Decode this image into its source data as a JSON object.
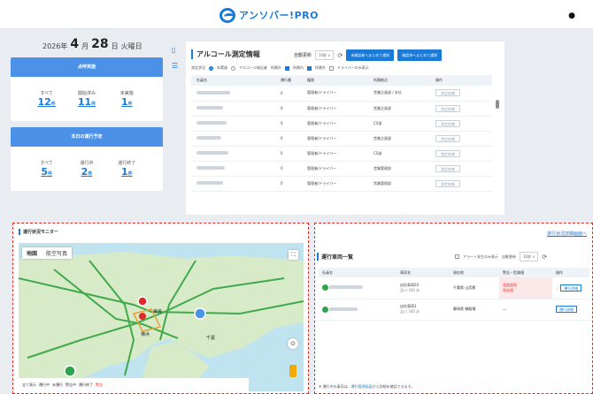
{
  "app": {
    "brand": "アンソバー!PRO",
    "bell": "●"
  },
  "date": {
    "year": "2026年",
    "month": "4",
    "month_suffix": "月",
    "day": "28",
    "day_suffix": "日",
    "weekday": "火曜日"
  },
  "cards": [
    {
      "title": "点呼実施",
      "items": [
        {
          "label": "すべて",
          "value": "12",
          "unit": "件"
        },
        {
          "label": "開始済み",
          "value": "11",
          "unit": "件"
        },
        {
          "label": "未実施",
          "value": "1",
          "unit": "件"
        }
      ]
    },
    {
      "title": "本日の運行予定",
      "items": [
        {
          "label": "すべて",
          "value": "5",
          "unit": "件"
        },
        {
          "label": "運行中",
          "value": "2",
          "unit": "件"
        },
        {
          "label": "運行終了",
          "value": "1",
          "unit": "件"
        }
      ]
    }
  ],
  "alcohol": {
    "title": "アルコール測定情報",
    "auto_update": "自動更新",
    "interval": "10秒 ∨",
    "btn_confirm": "未確認者へまとめて通知",
    "btn_check": "確認済へまとめて通知",
    "filter_label": "測定状況",
    "filters": [
      "未実施",
      "アルコール検出者",
      "所属外",
      "所属内",
      "所属外",
      "ドライバーのみ表示"
    ],
    "columns": [
      "社員名",
      "運行番",
      "権限",
      "所属拠点",
      "操作"
    ],
    "rows": [
      {
        "no": "0",
        "role": "管理者/ドライバー",
        "base": "営業企画部 / 本社",
        "btn": "測定依頼"
      },
      {
        "no": "0",
        "role": "管理者/ドライバー",
        "base": "営業企画部",
        "btn": "測定依頼"
      },
      {
        "no": "0",
        "role": "管理者/ドライバー",
        "base": "CS部",
        "btn": "測定依頼"
      },
      {
        "no": "0",
        "role": "管理者/ドライバー",
        "base": "営業企画部",
        "btn": "測定依頼"
      },
      {
        "no": "0",
        "role": "管理者/ドライバー",
        "base": "CS部",
        "btn": "測定依頼"
      },
      {
        "no": "0",
        "role": "管理者/ドライバー",
        "base": "営業管理部",
        "btn": "測定依頼"
      },
      {
        "no": "0",
        "role": "管理者/ドライバー",
        "base": "営業管理部",
        "btn": "測定依頼"
      }
    ]
  },
  "map_panel": {
    "title": "運行状況モニター",
    "tabs": [
      "地図",
      "航空写真"
    ],
    "bar": [
      "全て表示",
      "運行中",
      "未運行",
      "警告中",
      "運行終了",
      "警告"
    ],
    "labels": [
      "横浜",
      "千葉",
      "東京"
    ]
  },
  "vehicles": {
    "top_link": "運行状況詳細画面へ",
    "title": "運行車両一覧",
    "alert_only": "アラート発生のみ表示",
    "auto": "自動更新",
    "interval": "10秒 ∨",
    "columns": [
      "社員名",
      "車両名",
      "現在地",
      "警告・危険値",
      "操作"
    ],
    "rows": [
      {
        "car": "自社車両03",
        "car_sub": "品川 300 あ",
        "place": "千葉県 山武郡",
        "warn": "速度超過",
        "warn2": "急加速",
        "btn": "運行詳細",
        "status": "green"
      },
      {
        "car": "自社車両1",
        "car_sub": "品川 300 あ",
        "place": "静岡県 御殿場",
        "warn": "—",
        "warn2": "",
        "btn": "運行詳細",
        "status": "green"
      }
    ],
    "note_pre": "※ 運行中の車両は、",
    "note_link": "運行管理画面",
    "note_post": "から詳細を確認できます。"
  }
}
